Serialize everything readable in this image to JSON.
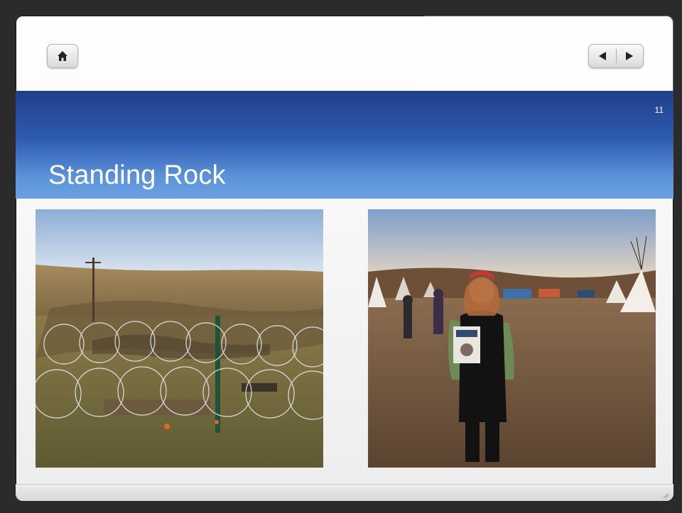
{
  "slide": {
    "number": "11",
    "title": "Standing Rock"
  },
  "nav": {
    "home_icon": "home-icon",
    "prev_icon": "triangle-left-icon",
    "next_icon": "triangle-right-icon"
  },
  "colors": {
    "band_top": "#1f3f8a",
    "band_bottom": "#6aa2e2",
    "title_text": "#ffffff"
  },
  "photos": {
    "left": "photo-barbed-wire-pipeline-site",
    "right": "photo-woman-holding-magazine-at-camp"
  }
}
